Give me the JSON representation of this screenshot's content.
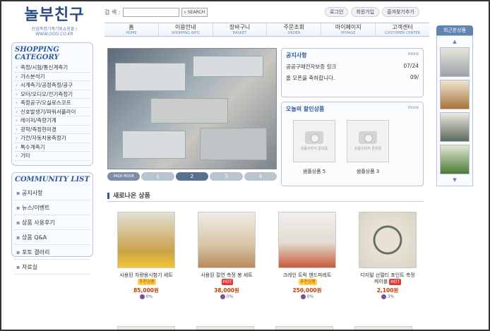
{
  "header": {
    "logo_title": "놀부친구",
    "logo_sub": "산업측정기계기류쇼핑몰 / WWW.OOO.CO.KR",
    "search_label": "검 색 :",
    "search_placeholder": "",
    "search_button": "SEARCH",
    "top_links": [
      "로그인",
      "회원가입",
      "즐겨찾기추가"
    ]
  },
  "nav": [
    {
      "ko": "홈",
      "en": "HOME"
    },
    {
      "ko": "이용안내",
      "en": "SHOPPING INFO"
    },
    {
      "ko": "장바구니",
      "en": "BASKET"
    },
    {
      "ko": "주문조회",
      "en": "ORDER"
    },
    {
      "ko": "마이페이지",
      "en": "MYPAGE"
    },
    {
      "ko": "고객센터",
      "en": "CUSTOMER CENTER"
    }
  ],
  "left": {
    "category_title": "SHOPPING CATEGORY",
    "categories": [
      "측정/시험/통신계측기",
      "가스분석기",
      "시계측기/공정측정/공구",
      "모터/오디오/전기측정기",
      "측정공구/오실로스코프",
      "신호발생기/파워서플라이",
      "레이저/측량기계",
      "광학/측정현미경",
      "가전/자동차용측정기",
      "특수계측기",
      "기타"
    ],
    "community_title": "COMMUNITY LIST",
    "community": [
      "공지사항",
      "뉴스/이벤트",
      "상품 사용후기",
      "상품 Q&A",
      "포토 갤러리",
      "자료실"
    ]
  },
  "banner": {
    "pager_label": "PAGE MOVE",
    "pages": [
      "1",
      "2",
      "3",
      "4"
    ],
    "active_page": 2
  },
  "notice": {
    "title": "공지사항",
    "more": "more",
    "items": [
      {
        "text": "공공구매전자보증 링크",
        "date": "07/24"
      },
      {
        "text": "홈 오픈을 축하합니다.",
        "date": "09/"
      }
    ]
  },
  "today": {
    "title": "오늘의 할인상품",
    "more": "more",
    "no_image": "상품이미지 준비중",
    "items": [
      "샘플상품 5",
      "샘플상품 3"
    ]
  },
  "new_products": {
    "title": "새로나온 상품",
    "items": [
      {
        "name": "사용된 차량용시험기 세트 ",
        "tag": "추천상품",
        "price": "85,000원",
        "point": "0%",
        "img": "#c9a24a"
      },
      {
        "name": "사용된 절연 측정 봉 세트",
        "tag": "HOT",
        "price": "38,000원",
        "point": "0%",
        "img": "#b98a5a"
      },
      {
        "name": "크레인 트럭 핸드파레트 ",
        "tag": "추천상품",
        "price": "250,000원",
        "point": "0%",
        "img": "#c85a3a"
      },
      {
        "name": "디지털 선멀티 포인트 측정 케이블",
        "tag": "HOT",
        "price": "2,100원",
        "point": "3%",
        "img": "#3a4a3a"
      }
    ]
  },
  "right": {
    "title": "최근본상품",
    "up": "▲",
    "down": "▼"
  },
  "colors": {
    "brand": "#2d5a9c",
    "accent": "#c04000"
  }
}
